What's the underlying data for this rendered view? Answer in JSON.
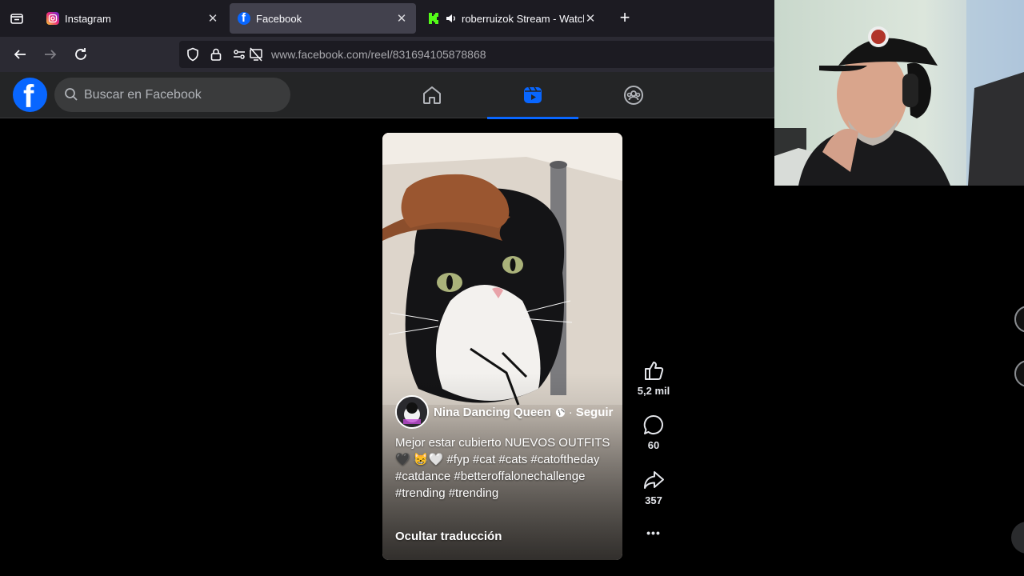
{
  "browser": {
    "tabs": [
      {
        "title": "Instagram",
        "favicon": "instagram-icon",
        "active": false
      },
      {
        "title": "Facebook",
        "favicon": "facebook-icon",
        "active": true
      },
      {
        "title": "roberruizok Stream - Watch",
        "favicon": "kick-icon",
        "audio": true,
        "active": false
      }
    ],
    "close_glyph": "✕",
    "new_tab_glyph": "+",
    "url_domain": "www.facebook.com",
    "url_path": "/reel/831694105878868"
  },
  "facebook": {
    "logo_letter": "f",
    "search_placeholder": "Buscar en Facebook",
    "active_nav": "reels"
  },
  "reel": {
    "owner_name": "Nina Dancing Queen",
    "globe_icon": "globe-icon",
    "separator": "·",
    "follow_label": "Seguir",
    "caption_text": "Mejor estar cubierto NUEVOS OUTFITS 🖤 😸🤍 #fyp #cat #cats #catoftheday #catdance #betteroffalonechallenge #trending #trending",
    "hide_translation_label": "Ocultar traducción"
  },
  "actions": {
    "likes": "5,2 mil",
    "comments": "60",
    "shares": "357",
    "more_glyph": "•••"
  },
  "colors": {
    "fb_blue": "#0866ff",
    "fb_header": "#242526",
    "browser_tabbar": "#1c1b22",
    "browser_toolbar": "#2b2a33"
  }
}
